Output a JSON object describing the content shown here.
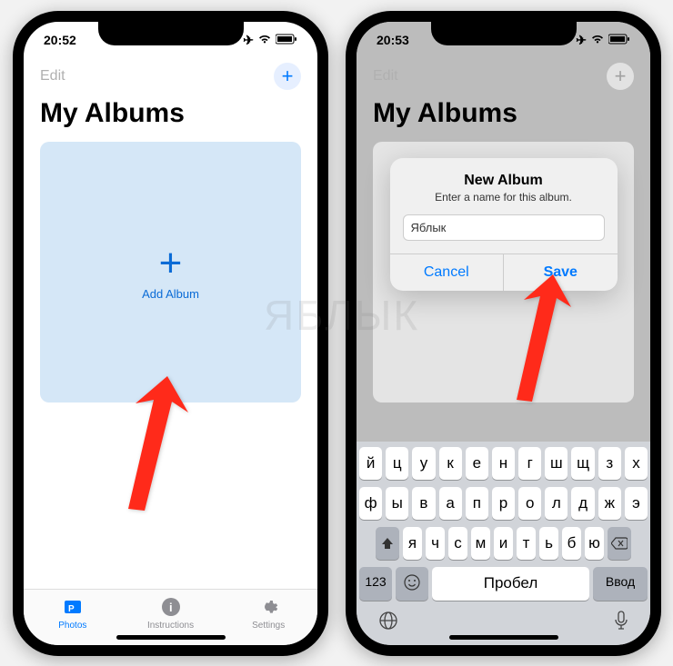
{
  "watermark": "ЯБЛЫК",
  "left_phone": {
    "status": {
      "time": "20:52"
    },
    "nav": {
      "edit": "Edit",
      "plus": "+"
    },
    "page_title": "My Albums",
    "add_album": {
      "plus": "+",
      "label": "Add Album"
    },
    "tabs": {
      "photos": "Photos",
      "instructions": "Instructions",
      "settings": "Settings"
    }
  },
  "right_phone": {
    "status": {
      "time": "20:53"
    },
    "nav": {
      "edit": "Edit",
      "plus": "+"
    },
    "page_title": "My Albums",
    "alert": {
      "title": "New Album",
      "message": "Enter a name for this album.",
      "input_value": "Яблык",
      "cancel": "Cancel",
      "save": "Save"
    },
    "keyboard": {
      "row1": [
        "й",
        "ц",
        "у",
        "к",
        "е",
        "н",
        "г",
        "ш",
        "щ",
        "з",
        "х"
      ],
      "row2": [
        "ф",
        "ы",
        "в",
        "а",
        "п",
        "р",
        "о",
        "л",
        "д",
        "ж",
        "э"
      ],
      "row3": [
        "я",
        "ч",
        "с",
        "м",
        "и",
        "т",
        "ь",
        "б",
        "ю"
      ],
      "num_key": "123",
      "space": "Пробел",
      "enter": "Ввод"
    }
  }
}
